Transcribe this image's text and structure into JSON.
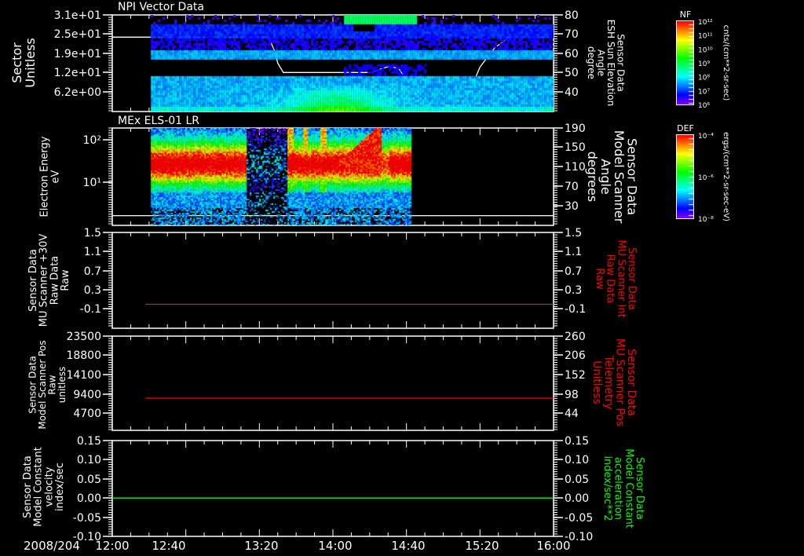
{
  "time_axis": {
    "date": "2008/204",
    "range": [
      "12:00",
      "16:00"
    ],
    "labels": [
      "12:00",
      "12:40",
      "13:20",
      "14:00",
      "14:40",
      "15:20",
      "16:00"
    ]
  },
  "colorbars": [
    {
      "title": "NF",
      "ticks": [
        "10¹²",
        "10¹¹",
        "10¹⁰",
        "10⁹",
        "10⁸",
        "10⁷",
        "10⁶"
      ],
      "units": "cnts/(cm**2-sr-sec)"
    },
    {
      "title": "DEF",
      "ticks": [
        "10⁻⁴",
        "10⁻⁶",
        "10⁻⁸"
      ],
      "units": "ergs/(cm**2-sr-sec-eV)"
    }
  ],
  "chart_data": [
    {
      "type": "heatmap",
      "title": "NPI Vector Data",
      "ylabel": [
        "Sector",
        "Unitless"
      ],
      "yticks": [
        "3.1e+01",
        "2.5e+01",
        "1.9e+01",
        "1.2e+01",
        "6.2e+00"
      ],
      "ylim": [
        0,
        31
      ],
      "colorbar": "NF",
      "data_start": "12:21",
      "overlay": {
        "type": "line",
        "color": "#ffffff",
        "ylabel": [
          "Sensor Data",
          "ESH Sun Elevation",
          "Angle",
          "degree"
        ],
        "yticks": [
          "80",
          "70",
          "60",
          "50",
          "40"
        ],
        "ylim": [
          30,
          80
        ],
        "points": [
          [
            "12:00",
            68.5
          ],
          [
            "13:25",
            68.5
          ],
          [
            "13:28",
            62
          ],
          [
            "13:30",
            55
          ],
          [
            "13:33",
            50.2
          ],
          [
            "14:21",
            50.2
          ],
          [
            "14:26",
            52
          ],
          [
            "14:31",
            53.5
          ],
          [
            "14:36",
            52
          ],
          [
            "14:41",
            45
          ],
          [
            "14:47",
            36
          ],
          [
            "15:00",
            33.5
          ],
          [
            "15:06",
            32
          ],
          [
            "15:12",
            36
          ],
          [
            "15:16",
            44
          ],
          [
            "15:20",
            53
          ],
          [
            "15:28",
            63
          ],
          [
            "15:36",
            68.5
          ],
          [
            "16:00",
            68.5
          ]
        ]
      }
    },
    {
      "type": "heatmap",
      "title": "MEx ELS-01 LR",
      "ylabel": [
        "Electron Energy",
        "eV"
      ],
      "yticks": [
        "10²",
        "10¹"
      ],
      "yscale": "log",
      "ylim": [
        1,
        190
      ],
      "colorbar": "DEF",
      "data_range": [
        "12:21",
        "14:42"
      ],
      "overlay": {
        "type": "line",
        "color": "#ffffff",
        "ylabel": [
          "Sensor Data",
          "Model Scanner",
          "Angle",
          "degrees"
        ],
        "yticks": [
          "190",
          "150",
          "110",
          "70",
          "30"
        ],
        "ylim": [
          -10,
          190
        ],
        "points": [
          [
            "12:00",
            10
          ],
          [
            "16:00",
            10
          ]
        ]
      }
    },
    {
      "type": "line",
      "ylabel": [
        "Sensor Data",
        "MU Scanner +30V",
        "Raw Data",
        "Raw"
      ],
      "yticks": [
        "1.5",
        "1.1",
        "0.7",
        "0.3",
        "-0.1"
      ],
      "ylim": [
        -0.5,
        1.5
      ],
      "right_ylabel": [
        "Sensor Data",
        "MU Scanner Int",
        "Raw Data",
        "Raw"
      ],
      "right_yticks": [
        "1.5",
        "1.1",
        "0.7",
        "0.3",
        "-0.1"
      ],
      "right_label_color": "#ff0000",
      "series": [
        {
          "color": "#6a4a4a",
          "points": [
            [
              "12:18",
              0
            ],
            [
              "16:00",
              0
            ]
          ]
        }
      ]
    },
    {
      "type": "line",
      "ylabel": [
        "Sensor Data",
        "Model Scanner Pos",
        "Raw",
        "unitless"
      ],
      "yticks": [
        "23500",
        "18800",
        "14100",
        "9400",
        "4700"
      ],
      "ylim": [
        0,
        23500
      ],
      "right_ylabel": [
        "Sensor Data",
        "MU Scanner Pos",
        "Telemetry",
        "Unitless"
      ],
      "right_yticks": [
        "260",
        "206",
        "152",
        "98",
        "44"
      ],
      "right_ylim": [
        -10,
        260
      ],
      "right_label_color": "#ff0000",
      "series": [
        {
          "color": "#ff0000",
          "points": [
            [
              "12:18",
              8000
            ],
            [
              "16:00",
              8000
            ]
          ]
        }
      ]
    },
    {
      "type": "line",
      "ylabel": [
        "Sensor Data",
        "Model Constant",
        "velocity",
        "index/sec"
      ],
      "yticks": [
        "0.15",
        "0.10",
        "0.05",
        "0.00",
        "-0.05",
        "-0.10"
      ],
      "ylim": [
        -0.1,
        0.15
      ],
      "right_ylabel": [
        "Sensor Data",
        "Model Constant",
        "acceleration",
        "index/sec**2"
      ],
      "right_yticks": [
        "0.15",
        "0.10",
        "0.05",
        "0.00",
        "-0.05",
        "-0.10"
      ],
      "right_label_color": "#00ff00",
      "series": [
        {
          "color": "#00ff00",
          "points": [
            [
              "12:00",
              0
            ],
            [
              "16:00",
              0
            ]
          ]
        }
      ]
    }
  ]
}
